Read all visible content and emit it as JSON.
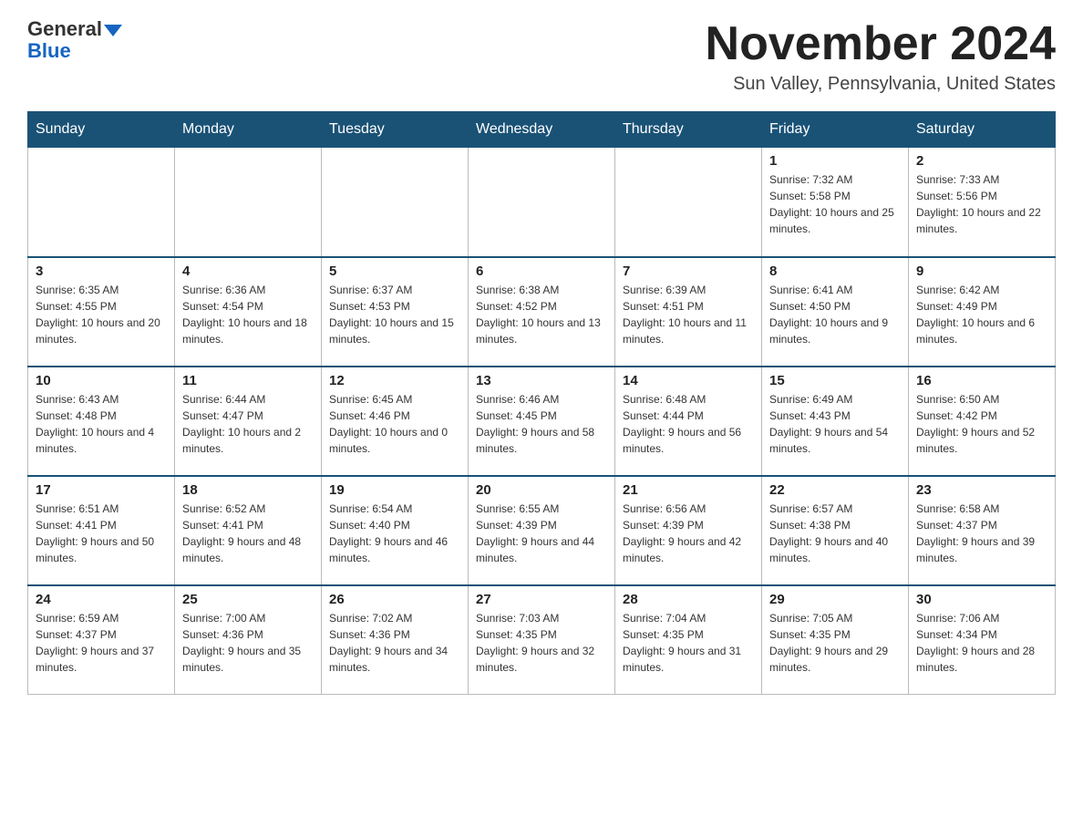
{
  "header": {
    "logo_general": "General",
    "logo_blue": "Blue",
    "month_title": "November 2024",
    "location": "Sun Valley, Pennsylvania, United States"
  },
  "calendar": {
    "days_of_week": [
      "Sunday",
      "Monday",
      "Tuesday",
      "Wednesday",
      "Thursday",
      "Friday",
      "Saturday"
    ],
    "weeks": [
      [
        {
          "day": "",
          "info": ""
        },
        {
          "day": "",
          "info": ""
        },
        {
          "day": "",
          "info": ""
        },
        {
          "day": "",
          "info": ""
        },
        {
          "day": "",
          "info": ""
        },
        {
          "day": "1",
          "info": "Sunrise: 7:32 AM\nSunset: 5:58 PM\nDaylight: 10 hours and 25 minutes."
        },
        {
          "day": "2",
          "info": "Sunrise: 7:33 AM\nSunset: 5:56 PM\nDaylight: 10 hours and 22 minutes."
        }
      ],
      [
        {
          "day": "3",
          "info": "Sunrise: 6:35 AM\nSunset: 4:55 PM\nDaylight: 10 hours and 20 minutes."
        },
        {
          "day": "4",
          "info": "Sunrise: 6:36 AM\nSunset: 4:54 PM\nDaylight: 10 hours and 18 minutes."
        },
        {
          "day": "5",
          "info": "Sunrise: 6:37 AM\nSunset: 4:53 PM\nDaylight: 10 hours and 15 minutes."
        },
        {
          "day": "6",
          "info": "Sunrise: 6:38 AM\nSunset: 4:52 PM\nDaylight: 10 hours and 13 minutes."
        },
        {
          "day": "7",
          "info": "Sunrise: 6:39 AM\nSunset: 4:51 PM\nDaylight: 10 hours and 11 minutes."
        },
        {
          "day": "8",
          "info": "Sunrise: 6:41 AM\nSunset: 4:50 PM\nDaylight: 10 hours and 9 minutes."
        },
        {
          "day": "9",
          "info": "Sunrise: 6:42 AM\nSunset: 4:49 PM\nDaylight: 10 hours and 6 minutes."
        }
      ],
      [
        {
          "day": "10",
          "info": "Sunrise: 6:43 AM\nSunset: 4:48 PM\nDaylight: 10 hours and 4 minutes."
        },
        {
          "day": "11",
          "info": "Sunrise: 6:44 AM\nSunset: 4:47 PM\nDaylight: 10 hours and 2 minutes."
        },
        {
          "day": "12",
          "info": "Sunrise: 6:45 AM\nSunset: 4:46 PM\nDaylight: 10 hours and 0 minutes."
        },
        {
          "day": "13",
          "info": "Sunrise: 6:46 AM\nSunset: 4:45 PM\nDaylight: 9 hours and 58 minutes."
        },
        {
          "day": "14",
          "info": "Sunrise: 6:48 AM\nSunset: 4:44 PM\nDaylight: 9 hours and 56 minutes."
        },
        {
          "day": "15",
          "info": "Sunrise: 6:49 AM\nSunset: 4:43 PM\nDaylight: 9 hours and 54 minutes."
        },
        {
          "day": "16",
          "info": "Sunrise: 6:50 AM\nSunset: 4:42 PM\nDaylight: 9 hours and 52 minutes."
        }
      ],
      [
        {
          "day": "17",
          "info": "Sunrise: 6:51 AM\nSunset: 4:41 PM\nDaylight: 9 hours and 50 minutes."
        },
        {
          "day": "18",
          "info": "Sunrise: 6:52 AM\nSunset: 4:41 PM\nDaylight: 9 hours and 48 minutes."
        },
        {
          "day": "19",
          "info": "Sunrise: 6:54 AM\nSunset: 4:40 PM\nDaylight: 9 hours and 46 minutes."
        },
        {
          "day": "20",
          "info": "Sunrise: 6:55 AM\nSunset: 4:39 PM\nDaylight: 9 hours and 44 minutes."
        },
        {
          "day": "21",
          "info": "Sunrise: 6:56 AM\nSunset: 4:39 PM\nDaylight: 9 hours and 42 minutes."
        },
        {
          "day": "22",
          "info": "Sunrise: 6:57 AM\nSunset: 4:38 PM\nDaylight: 9 hours and 40 minutes."
        },
        {
          "day": "23",
          "info": "Sunrise: 6:58 AM\nSunset: 4:37 PM\nDaylight: 9 hours and 39 minutes."
        }
      ],
      [
        {
          "day": "24",
          "info": "Sunrise: 6:59 AM\nSunset: 4:37 PM\nDaylight: 9 hours and 37 minutes."
        },
        {
          "day": "25",
          "info": "Sunrise: 7:00 AM\nSunset: 4:36 PM\nDaylight: 9 hours and 35 minutes."
        },
        {
          "day": "26",
          "info": "Sunrise: 7:02 AM\nSunset: 4:36 PM\nDaylight: 9 hours and 34 minutes."
        },
        {
          "day": "27",
          "info": "Sunrise: 7:03 AM\nSunset: 4:35 PM\nDaylight: 9 hours and 32 minutes."
        },
        {
          "day": "28",
          "info": "Sunrise: 7:04 AM\nSunset: 4:35 PM\nDaylight: 9 hours and 31 minutes."
        },
        {
          "day": "29",
          "info": "Sunrise: 7:05 AM\nSunset: 4:35 PM\nDaylight: 9 hours and 29 minutes."
        },
        {
          "day": "30",
          "info": "Sunrise: 7:06 AM\nSunset: 4:34 PM\nDaylight: 9 hours and 28 minutes."
        }
      ]
    ]
  }
}
